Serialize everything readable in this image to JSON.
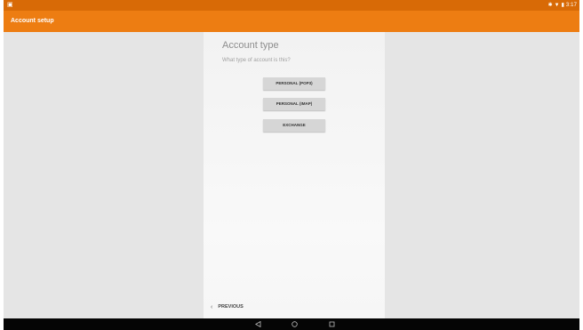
{
  "status_bar": {
    "left_icon": "notification-icon",
    "bluetooth_icon": "bluetooth-icon",
    "wifi_icon": "wifi-icon",
    "battery_icon": "battery-icon",
    "time": "3:17"
  },
  "app_bar": {
    "title": "Account setup",
    "color": "#ed7d12"
  },
  "card": {
    "title": "Account type",
    "subtitle": "What type of account is this?",
    "buttons": [
      {
        "label": "PERSONAL (POP3)"
      },
      {
        "label": "PERSONAL (IMAP)"
      },
      {
        "label": "EXCHANGE"
      }
    ],
    "previous_label": "PREVIOUS"
  },
  "nav_bar": {
    "back_icon": "back-triangle-icon",
    "home_icon": "home-circle-icon",
    "recents_icon": "recents-square-icon"
  }
}
